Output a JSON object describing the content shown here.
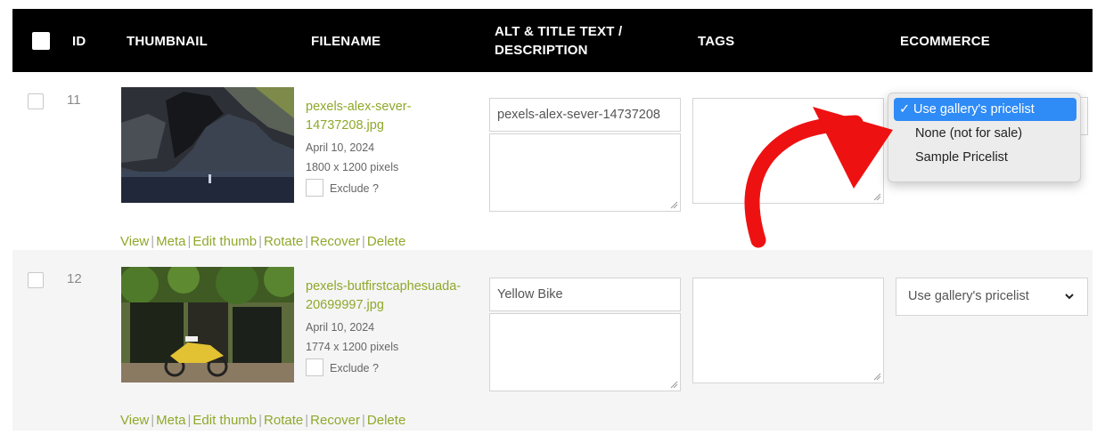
{
  "header": {
    "id": "ID",
    "thumbnail": "THUMBNAIL",
    "filename": "FILENAME",
    "alt_line1": "ALT & TITLE TEXT /",
    "alt_line2": "DESCRIPTION",
    "tags": "TAGS",
    "ecommerce": "ECOMMERCE"
  },
  "rows": [
    {
      "id": "11",
      "filename_line1": "pexels-alex-sever-",
      "filename_line2": "14737208.jpg",
      "date": "April 10, 2024",
      "dimensions": "1800 x 1200 pixels",
      "exclude_label": "Exclude ?",
      "alt_value": "pexels-alex-sever-14737208",
      "pricelist": "Use gallery's pricelist"
    },
    {
      "id": "12",
      "filename_line1": "pexels-butfirstcaphesuada-",
      "filename_line2": "20699997.jpg",
      "date": "April 10, 2024",
      "dimensions": "1774 x 1200 pixels",
      "exclude_label": "Exclude ?",
      "alt_value": "Yellow Bike",
      "pricelist": "Use gallery's pricelist"
    }
  ],
  "actions": {
    "view": "View",
    "meta": "Meta",
    "edit_thumb": "Edit thumb",
    "rotate": "Rotate",
    "recover": "Recover",
    "delete": "Delete",
    "separator": "|"
  },
  "dropdown": {
    "check": "✓",
    "options": [
      "Use gallery's pricelist",
      "None (not for sale)",
      "Sample Pricelist"
    ]
  },
  "colors": {
    "link": "#8fa82a",
    "header_bg": "#000000",
    "selected_option": "#2f8bf5",
    "arrow": "#ee1111"
  }
}
